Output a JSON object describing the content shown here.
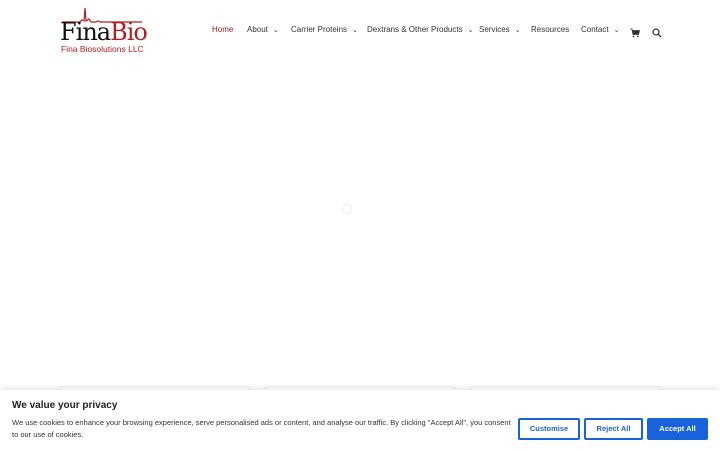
{
  "brand": {
    "logo_main_prefix": "Fina",
    "logo_main_suffix": "Bio",
    "logo_sub": "Fina Biosolutions LLC"
  },
  "nav": {
    "items": [
      {
        "label": "Home",
        "active": true,
        "has_dropdown": false
      },
      {
        "label": "About",
        "active": false,
        "has_dropdown": true
      },
      {
        "label": "Carrier Proteins",
        "active": false,
        "has_dropdown": true
      },
      {
        "label": "Dextrans & Other Products",
        "active": false,
        "has_dropdown": true
      },
      {
        "label": "Services",
        "active": false,
        "has_dropdown": true
      },
      {
        "label": "Resources",
        "active": false,
        "has_dropdown": false
      },
      {
        "label": "Contact",
        "active": false,
        "has_dropdown": true
      }
    ],
    "cart_icon": "cart-icon",
    "search_icon": "search-icon",
    "caret_glyph": "⌄"
  },
  "cookie": {
    "title": "We value your privacy",
    "text": "We use cookies to enhance your browsing experience, serve personalised ads or content, and analyse our traffic. By clicking \"Accept All\", you consent to our use of cookies.",
    "customise_label": "Customise",
    "reject_label": "Reject All",
    "accept_label": "Accept All"
  },
  "colors": {
    "accent": "#1863dc",
    "brand_red": "#b11e23",
    "nav_active": "#8b1a1e"
  }
}
